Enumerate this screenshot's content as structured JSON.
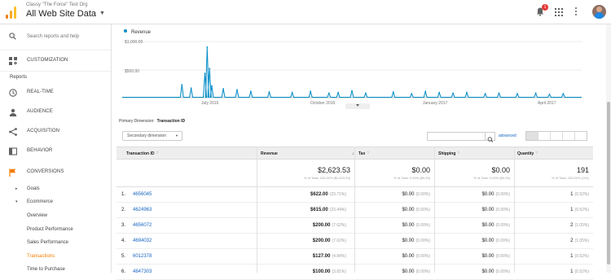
{
  "header": {
    "org": "Classy \"The Force\" Test Org",
    "property": "All Web Site Data",
    "notification_count": "1"
  },
  "sidebar": {
    "search_placeholder": "Search reports and help",
    "customization": "CUSTOMIZATION",
    "reports_heading": "Reports",
    "realtime": "REAL-TIME",
    "audience": "AUDIENCE",
    "acquisition": "ACQUISITION",
    "behavior": "BEHAVIOR",
    "conversions": "CONVERSIONS",
    "sub": {
      "goals": "Goals",
      "ecommerce": "Ecommerce",
      "overview": "Overview",
      "product_performance": "Product Performance",
      "sales_performance": "Sales Performance",
      "transactions": "Transactions",
      "time_to_purchase": "Time to Purchase"
    },
    "accent_color": "#f57c00"
  },
  "chart_data": {
    "type": "line",
    "series": [
      {
        "name": "Revenue"
      }
    ],
    "ylabels": [
      "$1,000.00",
      "$500.00"
    ],
    "xlabels": [
      "July 2016",
      "October 2016",
      "January 2017",
      "April 2017"
    ],
    "spikes": [
      [
        0.13,
        230
      ],
      [
        0.15,
        170
      ],
      [
        0.18,
        430
      ],
      [
        0.185,
        900
      ],
      [
        0.19,
        520
      ],
      [
        0.195,
        210
      ],
      [
        0.22,
        160
      ],
      [
        0.25,
        140
      ],
      [
        0.28,
        110
      ],
      [
        0.32,
        100
      ],
      [
        0.37,
        90
      ],
      [
        0.41,
        110
      ],
      [
        0.45,
        80
      ],
      [
        0.47,
        90
      ],
      [
        0.5,
        120
      ],
      [
        0.53,
        80
      ],
      [
        0.59,
        100
      ],
      [
        0.63,
        70
      ],
      [
        0.66,
        110
      ],
      [
        0.69,
        90
      ],
      [
        0.72,
        80
      ],
      [
        0.75,
        90
      ],
      [
        0.79,
        70
      ],
      [
        0.82,
        80
      ],
      [
        0.86,
        70
      ],
      [
        0.9,
        80
      ],
      [
        0.93,
        60
      ],
      [
        0.96,
        70
      ]
    ],
    "ylim": [
      0,
      1000
    ],
    "color": "#058dc7"
  },
  "table": {
    "primary_dimension_label": "Primary Dimension:",
    "primary_dimension_value": "Transaction ID",
    "secondary_dimension": "Secondary dimension",
    "advanced": "advanced",
    "columns": [
      "Transaction ID",
      "Revenue",
      "Tax",
      "Shipping",
      "Quantity"
    ],
    "totals": [
      {
        "big": "$2,623.53",
        "small": "% of Total: 100.00% ($2,623.53)"
      },
      {
        "big": "$0.00",
        "small": "% of Total: 0.00% ($0.00)"
      },
      {
        "big": "$0.00",
        "small": "% of Total: 0.00% ($0.00)"
      },
      {
        "big": "191",
        "small": "% of Total: 100.00% (191)"
      }
    ],
    "rows": [
      {
        "idx": "1.",
        "id": "4656045",
        "rev": "$622.00",
        "rev_pct": "(23.71%)",
        "tax": "$0.00",
        "tax_pct": "(0.00%)",
        "ship": "$0.00",
        "ship_pct": "(0.00%)",
        "qty": "1",
        "qty_pct": "(0.52%)"
      },
      {
        "idx": "2.",
        "id": "4624963",
        "rev": "$615.00",
        "rev_pct": "(23.44%)",
        "tax": "$0.00",
        "tax_pct": "(0.00%)",
        "ship": "$0.00",
        "ship_pct": "(0.00%)",
        "qty": "1",
        "qty_pct": "(0.52%)"
      },
      {
        "idx": "3.",
        "id": "4656072",
        "rev": "$200.00",
        "rev_pct": "(7.62%)",
        "tax": "$0.00",
        "tax_pct": "(0.00%)",
        "ship": "$0.00",
        "ship_pct": "(0.00%)",
        "qty": "2",
        "qty_pct": "(1.05%)"
      },
      {
        "idx": "4.",
        "id": "4694032",
        "rev": "$200.00",
        "rev_pct": "(7.62%)",
        "tax": "$0.00",
        "tax_pct": "(0.00%)",
        "ship": "$0.00",
        "ship_pct": "(0.00%)",
        "qty": "2",
        "qty_pct": "(1.05%)"
      },
      {
        "idx": "5.",
        "id": "6012378",
        "rev": "$127.00",
        "rev_pct": "(4.84%)",
        "tax": "$0.00",
        "tax_pct": "(0.00%)",
        "ship": "$0.00",
        "ship_pct": "(0.00%)",
        "qty": "1",
        "qty_pct": "(0.52%)"
      },
      {
        "idx": "6.",
        "id": "4847303",
        "rev": "$100.00",
        "rev_pct": "(3.81%)",
        "tax": "$0.00",
        "tax_pct": "(0.00%)",
        "ship": "$0.00",
        "ship_pct": "(0.00%)",
        "qty": "1",
        "qty_pct": "(0.52%)"
      }
    ]
  }
}
